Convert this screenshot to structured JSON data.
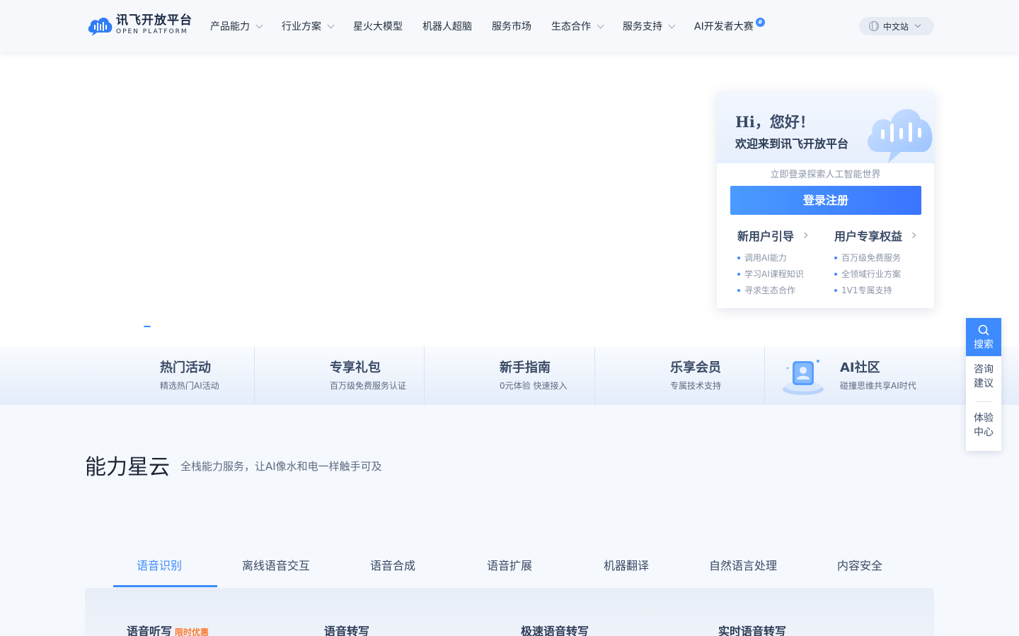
{
  "brand": {
    "name_cn": "讯飞开放平台",
    "name_en": "OPEN PLATFORM",
    "accent": "#3d8bff"
  },
  "nav": {
    "items": [
      {
        "label": "产品能力",
        "dropdown": true
      },
      {
        "label": "行业方案",
        "dropdown": true
      },
      {
        "label": "星火大模型",
        "dropdown": false
      },
      {
        "label": "机器人超脑",
        "dropdown": false
      },
      {
        "label": "服务市场",
        "dropdown": false
      },
      {
        "label": "生态合作",
        "dropdown": true
      },
      {
        "label": "服务支持",
        "dropdown": true
      },
      {
        "label": "AI开发者大赛",
        "dropdown": false
      }
    ],
    "badge": "#",
    "lang": "中文站"
  },
  "login": {
    "hi": "Hi，您好！",
    "welcome": "欢迎来到讯飞开放平台",
    "subtitle": "立即登录探索人工智能世界",
    "button": "登录注册",
    "col1": {
      "title": "新用户引导",
      "items": [
        "调用AI能力",
        "学习AI课程知识",
        "寻求生态合作"
      ]
    },
    "col2": {
      "title": "用户专享权益",
      "items": [
        "百万级免费服务",
        "全领域行业方案",
        "1V1专属支持"
      ]
    }
  },
  "quick": [
    {
      "title": "热门活动",
      "desc": "精选热门AI活动"
    },
    {
      "title": "专享礼包",
      "desc": "百万级免费服务认证"
    },
    {
      "title": "新手指南",
      "desc": "0元体验 快速接入"
    },
    {
      "title": "乐享会员",
      "desc": "专属技术支持"
    },
    {
      "title": "AI社区",
      "desc": "碰撞思维共享AI时代"
    }
  ],
  "float": {
    "search": "搜索",
    "consult": [
      "咨询",
      "建议"
    ],
    "experience": [
      "体验",
      "中心"
    ]
  },
  "section": {
    "title": "能力星云",
    "subtitle": "全栈能力服务，让AI像水和电一样触手可及",
    "tabs": [
      "语音识别",
      "离线语音交互",
      "语音合成",
      "语音扩展",
      "机器翻译",
      "自然语言处理",
      "内容安全"
    ],
    "active_tab": 0,
    "cards": [
      {
        "title": "语音听写",
        "tag": "限时优惠"
      },
      {
        "title": "语音转写",
        "tag": ""
      },
      {
        "title": "极速语音转写",
        "tag": ""
      },
      {
        "title": "实时语音转写",
        "tag": ""
      }
    ]
  }
}
